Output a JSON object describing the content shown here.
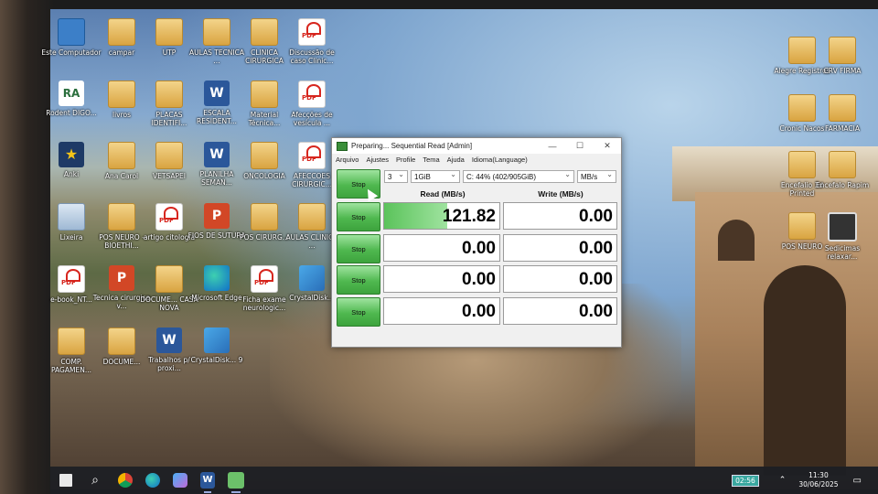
{
  "desktop": {
    "icons_left": [
      {
        "label": "Este Computador",
        "icon": "pc-icon"
      },
      {
        "label": "campar",
        "icon": "folder-icon"
      },
      {
        "label": "UTP",
        "icon": "folder-icon"
      },
      {
        "label": "AULAS TECNICA ...",
        "icon": "folder-icon"
      },
      {
        "label": "CLINICA CIRURGICA",
        "icon": "folder-icon"
      },
      {
        "label": "Discussão de caso Clinic...",
        "icon": "pdf-icon"
      },
      {
        "label": "Rodent DIGO...",
        "icon": "ra-icon"
      },
      {
        "label": "livros",
        "icon": "folder-icon"
      },
      {
        "label": "PLACAS IDENTIFI...",
        "icon": "folder-icon"
      },
      {
        "label": "ESCALA RESIDENT...",
        "icon": "word-icon"
      },
      {
        "label": "Material Técnica...",
        "icon": "folder-icon"
      },
      {
        "label": "Afecções de vesícula ...",
        "icon": "pdf-icon"
      },
      {
        "label": "Anki",
        "icon": "anki-icon"
      },
      {
        "label": "Ana Carol",
        "icon": "folder-icon"
      },
      {
        "label": "VETSAPEI",
        "icon": "folder-icon"
      },
      {
        "label": "PLANILHA SEMAN...",
        "icon": "word-icon"
      },
      {
        "label": "ONCOLOGIA",
        "icon": "folder-icon"
      },
      {
        "label": "AFECCOES CIRURGIC...",
        "icon": "pdf-icon"
      },
      {
        "label": "Lixeira",
        "icon": "recycle-bin-icon"
      },
      {
        "label": "POS NEURO - BIOETHI...",
        "icon": "folder-icon"
      },
      {
        "label": "artigo citologia",
        "icon": "pdf-icon"
      },
      {
        "label": "FIOS DE SUTURA",
        "icon": "ppt-icon"
      },
      {
        "label": "POS CIRURG...",
        "icon": "folder-icon"
      },
      {
        "label": "AULAS CLINICA ...",
        "icon": "folder-icon"
      },
      {
        "label": "e-book_NT...",
        "icon": "pdf-icon"
      },
      {
        "label": "Tecnica cirurgica v...",
        "icon": "ppt-icon"
      },
      {
        "label": "DOCUME... CASA NOVA",
        "icon": "folder-icon"
      },
      {
        "label": "Microsoft Edge",
        "icon": "edge-icon"
      },
      {
        "label": "Ficha exame neurologic...",
        "icon": "pdf-icon"
      },
      {
        "label": "CrystalDisk...",
        "icon": "crystaldisk-icon"
      },
      {
        "label": "COMP. PAGAMEN...",
        "icon": "folder-icon"
      },
      {
        "label": "DOCUME...",
        "icon": "folder-icon"
      },
      {
        "label": "Trabalhos p/ proxi...",
        "icon": "word-icon"
      },
      {
        "label": "CrystalDisk... 9",
        "icon": "crystaldisk-icon"
      }
    ],
    "icons_right": [
      {
        "label": "Alegre Registros",
        "icon": "folder-icon"
      },
      {
        "label": "CRV FIRMA",
        "icon": "folder-icon"
      },
      {
        "label": "Cronic Nacos",
        "icon": "folder-icon"
      },
      {
        "label": "FARMACIA",
        "icon": "folder-icon"
      },
      {
        "label": "Encefalio 3d Printed",
        "icon": "folder-icon"
      },
      {
        "label": "Encefalo Rapim",
        "icon": "folder-icon"
      },
      {
        "label": "POS NEURO",
        "icon": "folder-icon"
      },
      {
        "label": "Sedicimas relaxar...",
        "icon": "clock-icon"
      }
    ]
  },
  "window": {
    "title": "Preparing... Sequential Read [Admin]",
    "controls": {
      "minimize": "—",
      "maximize": "☐",
      "close": "✕"
    },
    "menu": [
      "Arquivo",
      "Ajustes",
      "Profile",
      "Tema",
      "Ajuda",
      "Idioma(Language)"
    ],
    "all_button": "Stop",
    "count": "3",
    "size": "1GiB",
    "drive": "C: 44% (402/905GiB)",
    "unit": "MB/s",
    "read_header": "Read (MB/s)",
    "write_header": "Write (MB/s)",
    "rows": [
      {
        "button": "Stop",
        "read": "121.82",
        "write": "0.00",
        "read_progress": 0.55
      },
      {
        "button": "Stop",
        "read": "0.00",
        "write": "0.00",
        "read_progress": 0
      },
      {
        "button": "Stop",
        "read": "0.00",
        "write": "0.00",
        "read_progress": 0
      },
      {
        "button": "Stop",
        "read": "0.00",
        "write": "0.00",
        "read_progress": 0
      }
    ],
    "accent": "#4fb84f"
  },
  "taskbar": {
    "battery": "02:56",
    "time": "11:30",
    "date": "30/06/2025",
    "items": [
      "start-icon",
      "search-icon",
      "chrome-icon",
      "edge-icon",
      "copilot-icon",
      "word-icon",
      "crystaldisk-icon"
    ]
  }
}
